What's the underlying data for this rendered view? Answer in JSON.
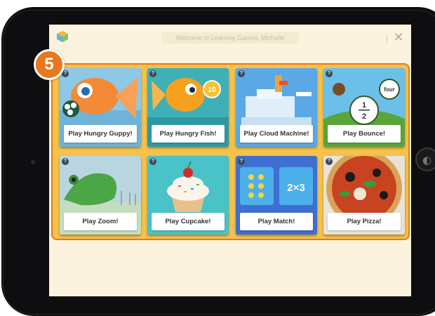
{
  "window": {
    "welcome_text": "Welcome to Learning Games, Michelle",
    "close_label": "✕"
  },
  "step_badge": "5",
  "games": [
    {
      "label": "Play Hungry Guppy!",
      "help": "?"
    },
    {
      "label": "Play Hungry Fish!",
      "help": "?"
    },
    {
      "label": "Play Cloud Machine!",
      "help": "?"
    },
    {
      "label": "Play Bounce!",
      "help": "?"
    },
    {
      "label": "Play Zoom!",
      "help": "?"
    },
    {
      "label": "Play Cupcake!",
      "help": "?"
    },
    {
      "label": "Play Match!",
      "help": "?"
    },
    {
      "label": "Play Pizza!",
      "help": "?"
    }
  ],
  "artwork": {
    "hungry_fish_number": "10",
    "bounce_word": "four",
    "bounce_fraction_numerator": "1",
    "bounce_fraction_denominator": "2",
    "match_expression": "2×3"
  },
  "colors": {
    "panel": "#f5c34c",
    "panel_border": "#e8781d",
    "badge": "#e8781d",
    "screen_bg": "#fbf3dd"
  },
  "icons": {
    "close": "close-icon",
    "help": "help-icon",
    "app_logo": "app-logo-icon"
  }
}
